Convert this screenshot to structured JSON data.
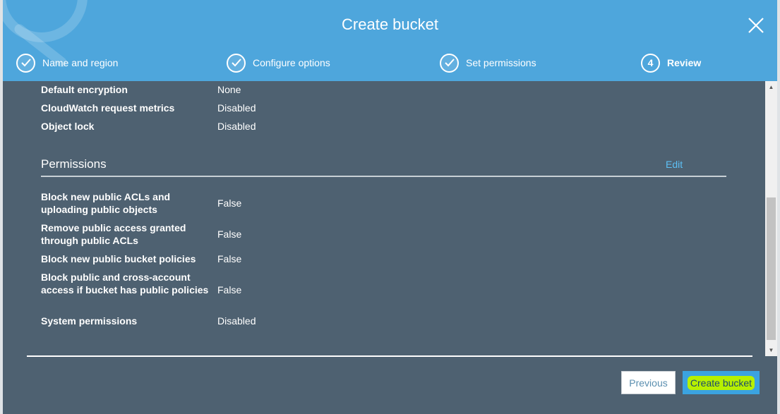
{
  "header": {
    "title": "Create bucket",
    "steps": [
      {
        "label": "Name and region",
        "state": "done"
      },
      {
        "label": "Configure options",
        "state": "done"
      },
      {
        "label": "Set permissions",
        "state": "done"
      },
      {
        "label": "Review",
        "number": "4",
        "state": "current"
      }
    ]
  },
  "options_rows": [
    {
      "label": "Default encryption",
      "value": "None"
    },
    {
      "label": "CloudWatch request metrics",
      "value": "Disabled"
    },
    {
      "label": "Object lock",
      "value": "Disabled"
    }
  ],
  "permissions": {
    "title": "Permissions",
    "edit_label": "Edit",
    "rows": [
      {
        "label": "Block new public ACLs and uploading public objects",
        "value": "False"
      },
      {
        "label": "Remove public access granted through public ACLs",
        "value": "False"
      },
      {
        "label": "Block new public bucket policies",
        "value": "False"
      },
      {
        "label": "Block public and cross-account access if bucket has public policies",
        "value": "False"
      },
      {
        "label": "System permissions",
        "value": "Disabled"
      }
    ]
  },
  "footer": {
    "previous_label": "Previous",
    "create_label": "Create bucket"
  },
  "colors": {
    "header_bg": "#4ea6dc",
    "body_bg": "#4e6171",
    "link": "#5dc0f5",
    "primary_button": "#3ba3e0",
    "highlight": "#b7f000"
  }
}
